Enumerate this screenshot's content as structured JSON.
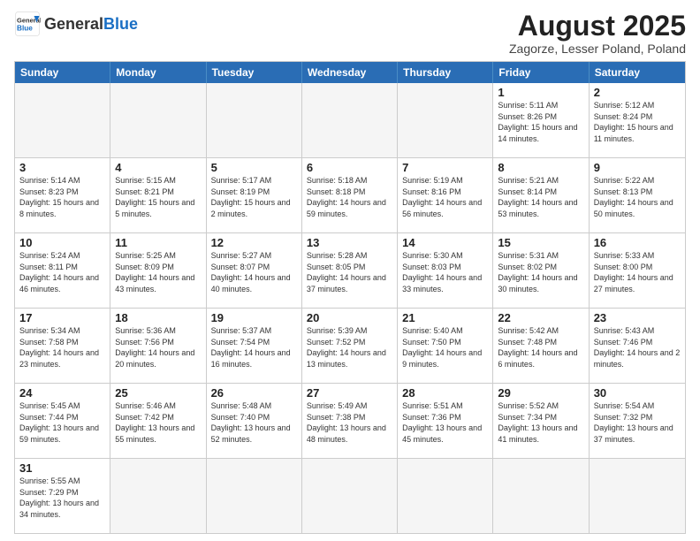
{
  "header": {
    "logo_general": "General",
    "logo_blue": "Blue",
    "title": "August 2025",
    "subtitle": "Zagorze, Lesser Poland, Poland"
  },
  "weekdays": [
    "Sunday",
    "Monday",
    "Tuesday",
    "Wednesday",
    "Thursday",
    "Friday",
    "Saturday"
  ],
  "rows": [
    [
      {
        "day": "",
        "empty": true
      },
      {
        "day": "",
        "empty": true
      },
      {
        "day": "",
        "empty": true
      },
      {
        "day": "",
        "empty": true
      },
      {
        "day": "",
        "empty": true
      },
      {
        "day": "1",
        "rise": "5:11 AM",
        "set": "8:26 PM",
        "daylight": "15 hours and 14 minutes."
      },
      {
        "day": "2",
        "rise": "5:12 AM",
        "set": "8:24 PM",
        "daylight": "15 hours and 11 minutes."
      }
    ],
    [
      {
        "day": "3",
        "rise": "5:14 AM",
        "set": "8:23 PM",
        "daylight": "15 hours and 8 minutes."
      },
      {
        "day": "4",
        "rise": "5:15 AM",
        "set": "8:21 PM",
        "daylight": "15 hours and 5 minutes."
      },
      {
        "day": "5",
        "rise": "5:17 AM",
        "set": "8:19 PM",
        "daylight": "15 hours and 2 minutes."
      },
      {
        "day": "6",
        "rise": "5:18 AM",
        "set": "8:18 PM",
        "daylight": "14 hours and 59 minutes."
      },
      {
        "day": "7",
        "rise": "5:19 AM",
        "set": "8:16 PM",
        "daylight": "14 hours and 56 minutes."
      },
      {
        "day": "8",
        "rise": "5:21 AM",
        "set": "8:14 PM",
        "daylight": "14 hours and 53 minutes."
      },
      {
        "day": "9",
        "rise": "5:22 AM",
        "set": "8:13 PM",
        "daylight": "14 hours and 50 minutes."
      }
    ],
    [
      {
        "day": "10",
        "rise": "5:24 AM",
        "set": "8:11 PM",
        "daylight": "14 hours and 46 minutes."
      },
      {
        "day": "11",
        "rise": "5:25 AM",
        "set": "8:09 PM",
        "daylight": "14 hours and 43 minutes."
      },
      {
        "day": "12",
        "rise": "5:27 AM",
        "set": "8:07 PM",
        "daylight": "14 hours and 40 minutes."
      },
      {
        "day": "13",
        "rise": "5:28 AM",
        "set": "8:05 PM",
        "daylight": "14 hours and 37 minutes."
      },
      {
        "day": "14",
        "rise": "5:30 AM",
        "set": "8:03 PM",
        "daylight": "14 hours and 33 minutes."
      },
      {
        "day": "15",
        "rise": "5:31 AM",
        "set": "8:02 PM",
        "daylight": "14 hours and 30 minutes."
      },
      {
        "day": "16",
        "rise": "5:33 AM",
        "set": "8:00 PM",
        "daylight": "14 hours and 27 minutes."
      }
    ],
    [
      {
        "day": "17",
        "rise": "5:34 AM",
        "set": "7:58 PM",
        "daylight": "14 hours and 23 minutes."
      },
      {
        "day": "18",
        "rise": "5:36 AM",
        "set": "7:56 PM",
        "daylight": "14 hours and 20 minutes."
      },
      {
        "day": "19",
        "rise": "5:37 AM",
        "set": "7:54 PM",
        "daylight": "14 hours and 16 minutes."
      },
      {
        "day": "20",
        "rise": "5:39 AM",
        "set": "7:52 PM",
        "daylight": "14 hours and 13 minutes."
      },
      {
        "day": "21",
        "rise": "5:40 AM",
        "set": "7:50 PM",
        "daylight": "14 hours and 9 minutes."
      },
      {
        "day": "22",
        "rise": "5:42 AM",
        "set": "7:48 PM",
        "daylight": "14 hours and 6 minutes."
      },
      {
        "day": "23",
        "rise": "5:43 AM",
        "set": "7:46 PM",
        "daylight": "14 hours and 2 minutes."
      }
    ],
    [
      {
        "day": "24",
        "rise": "5:45 AM",
        "set": "7:44 PM",
        "daylight": "13 hours and 59 minutes."
      },
      {
        "day": "25",
        "rise": "5:46 AM",
        "set": "7:42 PM",
        "daylight": "13 hours and 55 minutes."
      },
      {
        "day": "26",
        "rise": "5:48 AM",
        "set": "7:40 PM",
        "daylight": "13 hours and 52 minutes."
      },
      {
        "day": "27",
        "rise": "5:49 AM",
        "set": "7:38 PM",
        "daylight": "13 hours and 48 minutes."
      },
      {
        "day": "28",
        "rise": "5:51 AM",
        "set": "7:36 PM",
        "daylight": "13 hours and 45 minutes."
      },
      {
        "day": "29",
        "rise": "5:52 AM",
        "set": "7:34 PM",
        "daylight": "13 hours and 41 minutes."
      },
      {
        "day": "30",
        "rise": "5:54 AM",
        "set": "7:32 PM",
        "daylight": "13 hours and 37 minutes."
      }
    ],
    [
      {
        "day": "31",
        "rise": "5:55 AM",
        "set": "7:29 PM",
        "daylight": "13 hours and 34 minutes."
      },
      {
        "day": "",
        "empty": true
      },
      {
        "day": "",
        "empty": true
      },
      {
        "day": "",
        "empty": true
      },
      {
        "day": "",
        "empty": true
      },
      {
        "day": "",
        "empty": true
      },
      {
        "day": "",
        "empty": true
      }
    ]
  ]
}
